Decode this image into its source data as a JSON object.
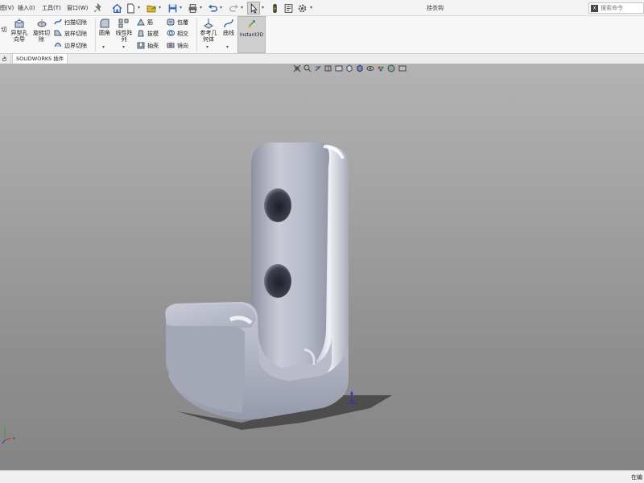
{
  "menu": {
    "view_label": "图(V)",
    "insert_label": "插入(I)",
    "tools_label": "工具(T)",
    "window_label": "窗口(W)"
  },
  "window": {
    "doc_title": "挂衣钩"
  },
  "search": {
    "placeholder": "搜索命令",
    "icon_label": "X"
  },
  "ribbon": {
    "cut_label": "切",
    "hole_wizard_label": "异型孔\n向导",
    "revolved_cut_label": "旋转切\n除",
    "swept_cut_label": "扫描切除",
    "lofted_cut_label": "放样切除",
    "boundary_cut_label": "边界切除",
    "fillet_label": "圆角",
    "linear_pattern_label": "线性阵\n列",
    "rib_label": "筋",
    "draft_label": "拔模",
    "shell_label": "抽壳",
    "wrap_label": "包覆",
    "intersect_label": "相交",
    "mirror_label": "镜向",
    "ref_geometry_label": "参考几\n何体",
    "curves_label": "曲线",
    "instant3d_label": "Instant3D"
  },
  "tabs": {
    "first_label": "占",
    "addins_label": "SOLIDWORKS 插件"
  },
  "status": {
    "text": "在编"
  },
  "colors": {
    "part_color": "#b9bcc8",
    "viewport_top": "#b3b3b3",
    "viewport_bottom": "#858585",
    "instant3d_bg": "#cfcfcf"
  },
  "icons": {
    "home": "home-icon",
    "new": "new-document-icon",
    "open": "open-folder-icon",
    "save": "save-icon",
    "print": "print-icon",
    "undo": "undo-icon",
    "redo": "redo-icon",
    "select": "select-pointer-icon",
    "traffic": "rebuild-light-icon",
    "filemgr": "file-properties-icon",
    "options": "gear-icon"
  }
}
